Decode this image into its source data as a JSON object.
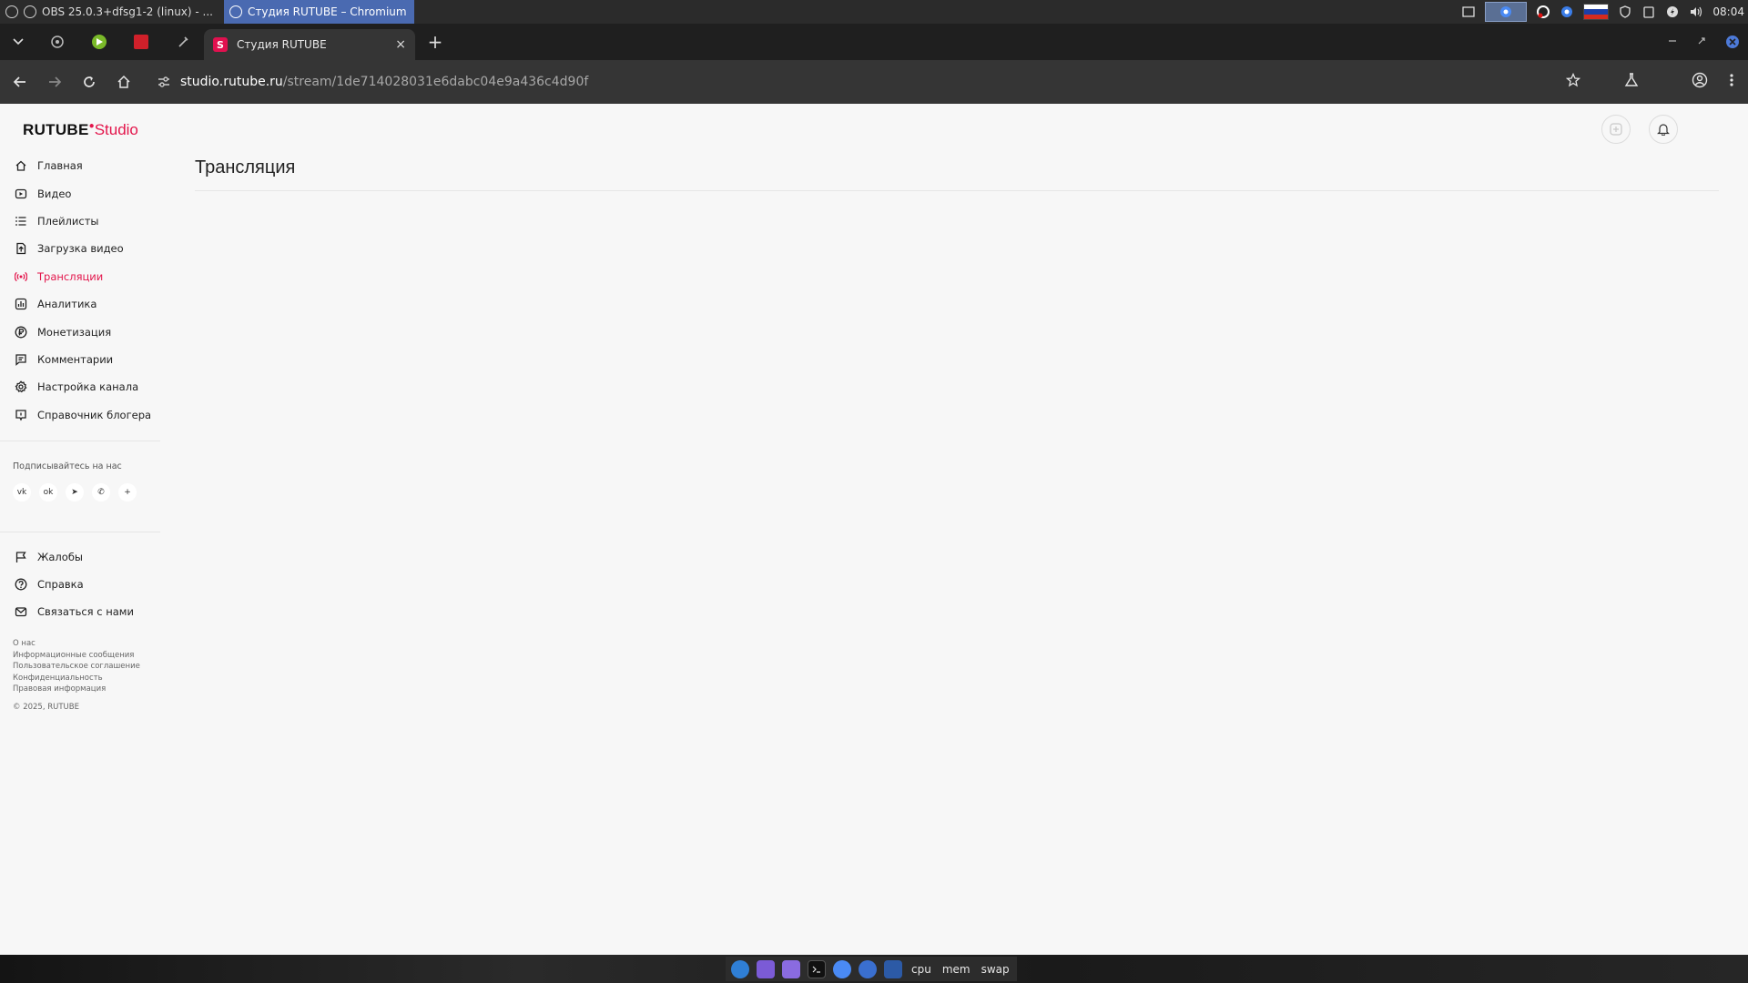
{
  "os_panel": {
    "tasks": [
      {
        "label": "OBS 25.0.3+dfsg1-2 (linux) - ..."
      },
      {
        "label": "Студия RUTUBE – Chromium"
      }
    ],
    "clock": "08:04",
    "flag_colors": [
      "#ffffff",
      "#1c3fa8",
      "#d52b1e"
    ]
  },
  "browser": {
    "tab": {
      "favicon_letter": "S",
      "title": "Студия RUTUBE",
      "close": "×"
    },
    "new_tab": "+",
    "url_host": "studio.rutube.ru",
    "url_path": "/stream/1de714028031e6dabc04e9a436c4d90f"
  },
  "sidebar": {
    "logo_main": "RUTUBE",
    "logo_sub": "Studio",
    "items": [
      {
        "label": "Главная",
        "icon": "home-icon"
      },
      {
        "label": "Видео",
        "icon": "video-icon"
      },
      {
        "label": "Плейлисты",
        "icon": "list-icon"
      },
      {
        "label": "Загрузка видео",
        "icon": "upload-icon"
      },
      {
        "label": "Трансляции",
        "icon": "broadcast-icon",
        "active": true
      },
      {
        "label": "Аналитика",
        "icon": "analytics-icon"
      },
      {
        "label": "Монетизация",
        "icon": "ruble-icon"
      },
      {
        "label": "Комментарии",
        "icon": "comment-icon"
      },
      {
        "label": "Настройка канала",
        "icon": "settings-icon"
      },
      {
        "label": "Справочник блогера",
        "icon": "guide-icon"
      }
    ],
    "follow_label": "Подписывайтесь на нас",
    "socials": [
      "vk",
      "ok",
      "telegram",
      "viber",
      "more"
    ],
    "social_labels": {
      "vk": "vk",
      "ok": "ok",
      "telegram": "➤",
      "viber": "✆",
      "more": "+"
    },
    "bottom_items": [
      {
        "label": "Жалобы",
        "icon": "flag-icon"
      },
      {
        "label": "Справка",
        "icon": "help-icon"
      },
      {
        "label": "Связаться с нами",
        "icon": "mail-icon"
      }
    ],
    "footer_links": [
      "О нас",
      "Информационные сообщения",
      "Пользовательское соглашение",
      "Конфиденциальность",
      "Правовая информация"
    ],
    "copyright": "© 2025, RUTUBE"
  },
  "main": {
    "title": "Трансляция"
  },
  "taskbar": {
    "labels": [
      "cpu",
      "mem",
      "swap"
    ]
  },
  "colors": {
    "accent": "#e3154b",
    "page_bg": "#f7f7f7"
  }
}
